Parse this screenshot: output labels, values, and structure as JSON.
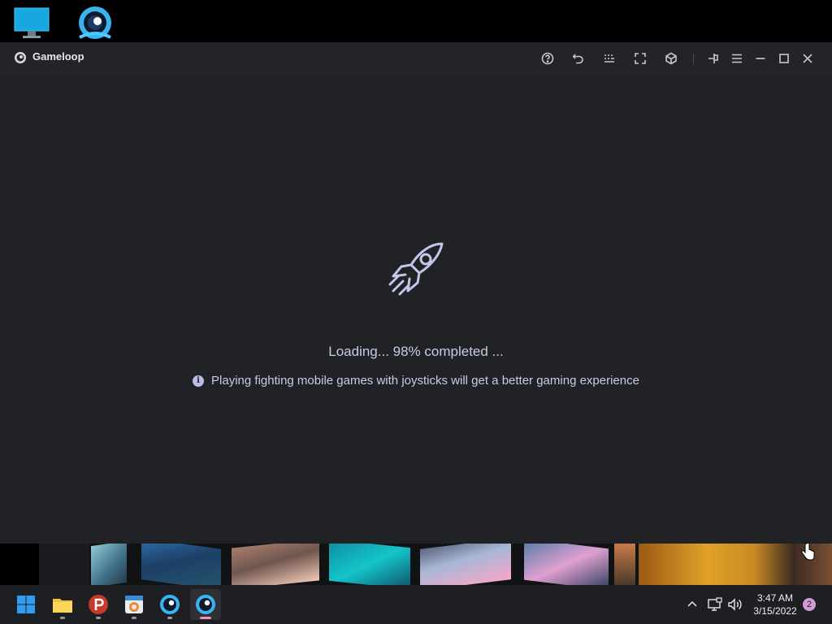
{
  "window": {
    "title": "Gameloop",
    "toolbar_icons": [
      "help-icon",
      "undo-icon",
      "keymap-icon",
      "fullscreen-icon",
      "3d-box-icon",
      "pin-icon",
      "menu-icon",
      "minimize-icon",
      "maximize-icon",
      "close-icon"
    ]
  },
  "loading": {
    "text": "Loading... 98% completed ...",
    "progress_percent": 98,
    "tip_icon": "i",
    "tip": "Playing fighting mobile games with joysticks will get a better gaming experience"
  },
  "taskbar": {
    "apps": [
      "start",
      "file-explorer",
      "p-app",
      "photo-editor",
      "gameloop",
      "gameloop-active"
    ],
    "time": "3:47 AM",
    "date": "3/15/2022",
    "notification_count": "2"
  },
  "colors": {
    "window_bg": "#202226",
    "text_accent": "#c9cbe6",
    "taskbar_bg": "#1e1f23",
    "active_indicator": "#f08fbf"
  }
}
